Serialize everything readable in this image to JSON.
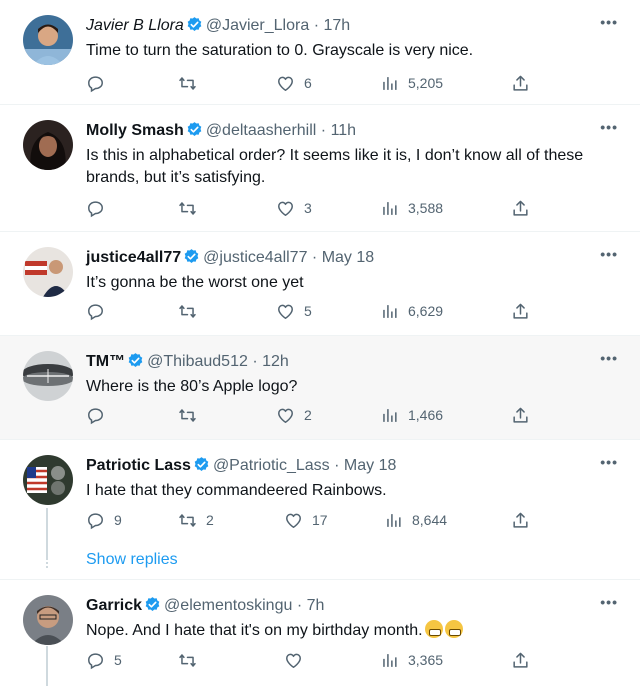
{
  "colors": {
    "accent": "#1d9bf0",
    "muted": "#536471",
    "text": "#0f1419",
    "highlight_bg": "#f7f7f7"
  },
  "tweets": [
    {
      "name": "Javier B Llora",
      "handle": "@Javier_Llora",
      "time": "· 17h",
      "text": "Time to turn the saturation to 0. Grayscale is very nice.",
      "replies": "",
      "retweets": "",
      "likes": "6",
      "views": "5,205"
    },
    {
      "name": "Molly Smash",
      "handle": "@deltaasherhill",
      "time": "· 11h",
      "text": "Is this in alphabetical order? It seems like it is, I don’t know all of these brands, but it’s satisfying.",
      "replies": "",
      "retweets": "",
      "likes": "3",
      "views": "3,588"
    },
    {
      "name": "justice4all77",
      "handle": "@justice4all77",
      "time": "· May 18",
      "text": "It’s gonna be the worst one yet",
      "replies": "",
      "retweets": "",
      "likes": "5",
      "views": "6,629"
    },
    {
      "name": "TM™",
      "handle": "@Thibaud512",
      "time": "· 12h",
      "text": "Where is the 80’s Apple logo?",
      "replies": "",
      "retweets": "",
      "likes": "2",
      "views": "1,466"
    },
    {
      "name": "Patriotic Lass",
      "handle": "@Patriotic_Lass",
      "time": "· May 18",
      "text": "I hate that they commandeered Rainbows.",
      "replies": "9",
      "retweets": "2",
      "likes": "17",
      "views": "8,644"
    },
    {
      "name": "Garrick",
      "handle": "@elementoskingu",
      "time": "· 7h",
      "text": "Nope. And I hate that it's on my birthday month.",
      "replies": "5",
      "retweets": "",
      "likes": "",
      "views": "3,365"
    }
  ],
  "show_replies": "Show replies",
  "icons": {
    "more": "more-icon",
    "reply": "reply-icon",
    "retweet": "retweet-icon",
    "like": "like-icon",
    "views": "views-icon",
    "share": "share-icon",
    "verified": "verified-icon",
    "emoji": "grimacing-emoji"
  },
  "more_label": "•••"
}
